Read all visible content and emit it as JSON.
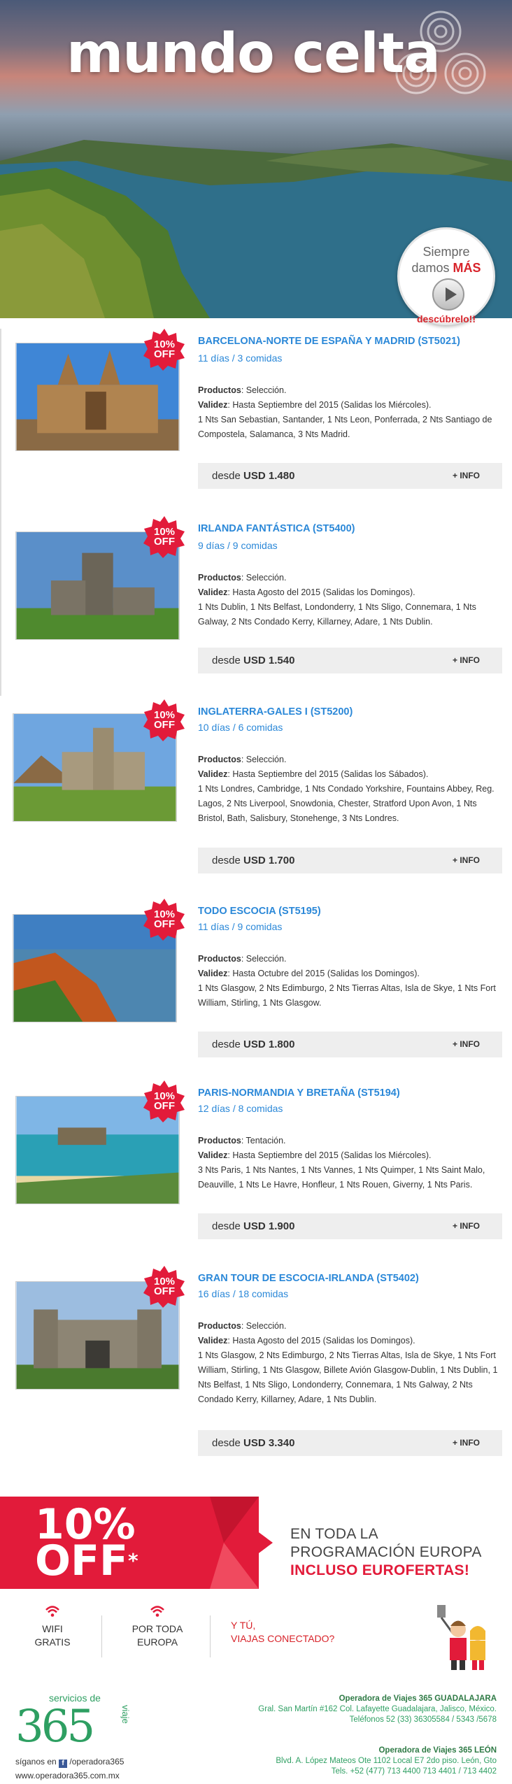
{
  "hero": {
    "title": "mundo celta",
    "badge_line1": "Siempre",
    "badge_line2a": "damos ",
    "badge_line2b": "MÁS",
    "badge_cta": "descúbrelo!!"
  },
  "offer_badge": "10% OFF",
  "tours": [
    {
      "name": "BARCELONA-NORTE DE ESPAÑA Y MADRID (ST5021)",
      "duration": "11 días / 3 comidas",
      "productos_label": "Productos",
      "productos": ": Selección.",
      "validez_label": "Validez",
      "validez": ": Hasta Septiembre del 2015  (Salidas los Miércoles).",
      "itinerary": "1 Nts San Sebastian, Santander, 1 Nts Leon, Ponferrada, 2 Nts Santiago de Compostela, Salamanca, 3 Nts Madrid.",
      "price_prefix": "desde ",
      "price": "USD 1.480",
      "info": "+ INFO"
    },
    {
      "name": "IRLANDA FANTÁSTICA (ST5400)",
      "duration": "9 días / 9 comidas",
      "productos_label": "Productos",
      "productos": ": Selección.",
      "validez_label": "Validez",
      "validez": ": Hasta Agosto del 2015 (Salidas los Domingos).",
      "itinerary": "1 Nts Dublin, 1 Nts Belfast, Londonderry, 1 Nts Sligo, Connemara, 1 Nts Galway, 2 Nts Condado Kerry, Killarney, Adare, 1 Nts Dublin.",
      "price_prefix": "desde ",
      "price": "USD 1.540",
      "info": "+ INFO"
    },
    {
      "name": "INGLATERRA-GALES I (ST5200)",
      "duration": "10 días / 6 comidas",
      "productos_label": "Productos",
      "productos": ": Selección.",
      "validez_label": "Validez",
      "validez": ": Hasta  Septiembre del 2015 (Salidas los Sábados).",
      "itinerary": "1 Nts Londres, Cambridge, 1 Nts Condado Yorkshire, Fountains Abbey, Reg. Lagos, 2 Nts Liverpool, Snowdonia, Chester, Stratford Upon Avon, 1 Nts Bristol, Bath, Salisbury, Stonehenge, 3 Nts Londres.",
      "price_prefix": "desde ",
      "price": "USD 1.700",
      "info": "+ INFO"
    },
    {
      "name": "TODO ESCOCIA (ST5195)",
      "duration": "11 días / 9 comidas",
      "productos_label": "Productos",
      "productos": ": Selección.",
      "validez_label": "Validez",
      "validez": ": Hasta Octubre del 2015 (Salidas los Domingos).",
      "itinerary": "1 Nts Glasgow, 2 Nts Edimburgo, 2 Nts Tierras Altas, Isla de Skye, 1 Nts Fort William, Stirling, 1 Nts Glasgow.",
      "price_prefix": "desde ",
      "price": "USD 1.800",
      "info": "+ INFO"
    },
    {
      "name": "PARIS-NORMANDIA Y BRETAÑA (ST5194)",
      "duration": "12 días / 8 comidas",
      "productos_label": "Productos",
      "productos": ": Tentación.",
      "validez_label": "Validez",
      "validez": ": Hasta Septiembre del 2015 (Salidas los Miércoles).",
      "itinerary": "3 Nts Paris, 1 Nts Nantes, 1 Nts Vannes, 1 Nts Quimper, 1 Nts Saint Malo, Deauville, 1 Nts Le Havre, Honfleur, 1 Nts Rouen, Giverny, 1 Nts Paris.",
      "price_prefix": "desde ",
      "price": "USD 1.900",
      "info": "+ INFO"
    },
    {
      "name": "GRAN TOUR DE ESCOCIA-IRLANDA (ST5402)",
      "duration": "16 días / 18 comidas",
      "productos_label": "Productos",
      "productos": ": Selección.",
      "validez_label": "Validez",
      "validez": ": Hasta Agosto del 2015 (Salidas los Domingos).",
      "itinerary": "1 Nts Glasgow, 2 Nts Edimburgo, 2 Nts Tierras Altas, Isla de Skye, 1 Nts Fort William, Stirling, 1 Nts Glasgow, Billete Avión Glasgow-Dublin, 1 Nts Dublin, 1 Nts Belfast, 1 Nts Sligo, Londonderry, Connemara, 1 Nts Galway, 2 Nts Condado Kerry, Killarney, Adare, 1 Nts Dublin.",
      "price_prefix": "desde ",
      "price": "USD 3.340",
      "info": "+ INFO"
    }
  ],
  "promo": {
    "big_line1": "10%",
    "big_line2": "OFF",
    "star": "*",
    "line1": "EN TODA LA",
    "line2": "PROGRAMACIÓN EUROPA",
    "line3": "INCLUSO EUROFERTAS!"
  },
  "connect": {
    "item1_a": "WIFI",
    "item1_b": "GRATIS",
    "item2_a": "POR TODA",
    "item2_b": "EUROPA",
    "question_a": "Y TÚ,",
    "question_b": "VIAJAS CONECTADO?"
  },
  "footer": {
    "logo_top": "servicios de",
    "logo_num": "365",
    "logo_side": "viaje",
    "follow_prefix": "síganos en ",
    "fb_letter": "f",
    "follow_handle": " /operadora365",
    "website": "www.operadora365.com.mx",
    "office1_name": "Operadora de Viajes 365 GUADALAJARA",
    "office1_addr": "Gral. San Martín #162 Col. Lafayette Guadalajara, Jalisco, México.",
    "office1_tel": "Teléfonos 52 (33) 36305584 / 5343 /5678",
    "office2_name": "Operadora de Viajes 365 LEÓN",
    "office2_addr": "Blvd. A. López Mateos Ote 1102 Local E7 2do piso. León, Gto",
    "office2_tel": "Tels. +52 (477) 713 4400 713 4401 / 713 4402"
  },
  "colors": {
    "accent_blue": "#2b88d8",
    "accent_red": "#e21b3a",
    "brand_green": "#2e9f62"
  }
}
